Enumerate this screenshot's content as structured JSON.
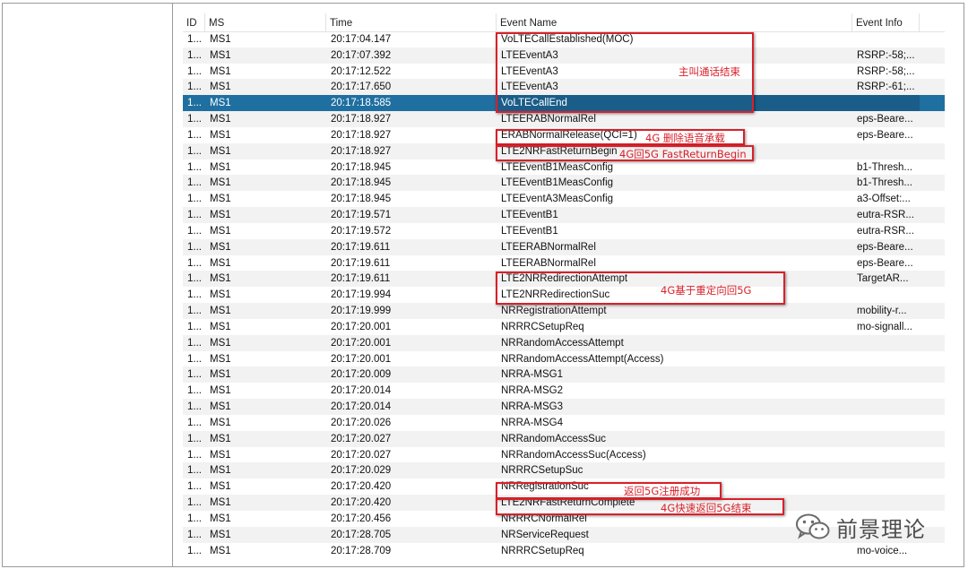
{
  "columns": {
    "id": "ID",
    "ms": "MS",
    "time": "Time",
    "event": "Event Name",
    "info": "Event Info"
  },
  "rows": [
    {
      "id": "1...",
      "ms": "MS1",
      "time": "20:17:04.147",
      "event": "VoLTECallEstablished(MOC)",
      "info": ""
    },
    {
      "id": "1...",
      "ms": "MS1",
      "time": "20:17:07.392",
      "event": "LTEEventA3",
      "info": "RSRP:-58;..."
    },
    {
      "id": "1...",
      "ms": "MS1",
      "time": "20:17:12.522",
      "event": "LTEEventA3",
      "info": "RSRP:-58;..."
    },
    {
      "id": "1...",
      "ms": "MS1",
      "time": "20:17:17.650",
      "event": "LTEEventA3",
      "info": "RSRP:-61;..."
    },
    {
      "id": "1...",
      "ms": "MS1",
      "time": "20:17:18.585",
      "event": "VoLTECallEnd",
      "info": "",
      "selected": true
    },
    {
      "id": "1...",
      "ms": "MS1",
      "time": "20:17:18.927",
      "event": "LTEERABNormalRel",
      "info": "eps-Beare..."
    },
    {
      "id": "1...",
      "ms": "MS1",
      "time": "20:17:18.927",
      "event": "ERABNormalRelease(QCI=1)",
      "info": "eps-Beare..."
    },
    {
      "id": "1...",
      "ms": "MS1",
      "time": "20:17:18.927",
      "event": "LTE2NRFastReturnBegin",
      "info": ""
    },
    {
      "id": "1...",
      "ms": "MS1",
      "time": "20:17:18.945",
      "event": "LTEEventB1MeasConfig",
      "info": "b1-Thresh..."
    },
    {
      "id": "1...",
      "ms": "MS1",
      "time": "20:17:18.945",
      "event": "LTEEventB1MeasConfig",
      "info": "b1-Thresh..."
    },
    {
      "id": "1...",
      "ms": "MS1",
      "time": "20:17:18.945",
      "event": "LTEEventA3MeasConfig",
      "info": "a3-Offset:..."
    },
    {
      "id": "1...",
      "ms": "MS1",
      "time": "20:17:19.571",
      "event": "LTEEventB1",
      "info": "eutra-RSR..."
    },
    {
      "id": "1...",
      "ms": "MS1",
      "time": "20:17:19.572",
      "event": "LTEEventB1",
      "info": "eutra-RSR..."
    },
    {
      "id": "1...",
      "ms": "MS1",
      "time": "20:17:19.611",
      "event": "LTEERABNormalRel",
      "info": "eps-Beare..."
    },
    {
      "id": "1...",
      "ms": "MS1",
      "time": "20:17:19.611",
      "event": "LTEERABNormalRel",
      "info": "eps-Beare..."
    },
    {
      "id": "1...",
      "ms": "MS1",
      "time": "20:17:19.611",
      "event": "LTE2NRRedirectionAttempt",
      "info": "TargetAR..."
    },
    {
      "id": "1...",
      "ms": "MS1",
      "time": "20:17:19.994",
      "event": "LTE2NRRedirectionSuc",
      "info": ""
    },
    {
      "id": "1...",
      "ms": "MS1",
      "time": "20:17:19.999",
      "event": "NRRegistrationAttempt",
      "info": "mobility-r..."
    },
    {
      "id": "1...",
      "ms": "MS1",
      "time": "20:17:20.001",
      "event": "NRRRCSetupReq",
      "info": "mo-signall..."
    },
    {
      "id": "1...",
      "ms": "MS1",
      "time": "20:17:20.001",
      "event": "NRRandomAccessAttempt",
      "info": ""
    },
    {
      "id": "1...",
      "ms": "MS1",
      "time": "20:17:20.001",
      "event": "NRRandomAccessAttempt(Access)",
      "info": ""
    },
    {
      "id": "1...",
      "ms": "MS1",
      "time": "20:17:20.009",
      "event": "NRRA-MSG1",
      "info": ""
    },
    {
      "id": "1...",
      "ms": "MS1",
      "time": "20:17:20.014",
      "event": "NRRA-MSG2",
      "info": ""
    },
    {
      "id": "1...",
      "ms": "MS1",
      "time": "20:17:20.014",
      "event": "NRRA-MSG3",
      "info": ""
    },
    {
      "id": "1...",
      "ms": "MS1",
      "time": "20:17:20.026",
      "event": "NRRA-MSG4",
      "info": ""
    },
    {
      "id": "1...",
      "ms": "MS1",
      "time": "20:17:20.027",
      "event": "NRRandomAccessSuc",
      "info": ""
    },
    {
      "id": "1...",
      "ms": "MS1",
      "time": "20:17:20.027",
      "event": "NRRandomAccessSuc(Access)",
      "info": ""
    },
    {
      "id": "1...",
      "ms": "MS1",
      "time": "20:17:20.029",
      "event": "NRRRCSetupSuc",
      "info": ""
    },
    {
      "id": "1...",
      "ms": "MS1",
      "time": "20:17:20.420",
      "event": "NRRegistrationSuc",
      "info": ""
    },
    {
      "id": "1...",
      "ms": "MS1",
      "time": "20:17:20.420",
      "event": "LTE2NRFastReturnComplete",
      "info": ""
    },
    {
      "id": "1...",
      "ms": "MS1",
      "time": "20:17:20.456",
      "event": "NRRRCNormalRel",
      "info": ""
    },
    {
      "id": "1...",
      "ms": "MS1",
      "time": "20:17:28.705",
      "event": "NRServiceRequest",
      "info": ""
    },
    {
      "id": "1...",
      "ms": "MS1",
      "time": "20:17:28.709",
      "event": "NRRRCSetupReq",
      "info": "mo-voice..."
    }
  ],
  "annotations": {
    "call_end": "主叫通话结束",
    "erab_release": "4G 删除语音承载",
    "fast_return_begin": "4G回5G FastReturnBegin",
    "redirection": "4G基于重定向回5G",
    "registration_suc": "返回5G注册成功",
    "fast_return_complete": "4G快速返回5G结束"
  },
  "annotation_color": "#d9202a",
  "selection_color": "#1f6fa0",
  "watermark": {
    "icon": "wechat-icon",
    "text": "前景理论"
  }
}
